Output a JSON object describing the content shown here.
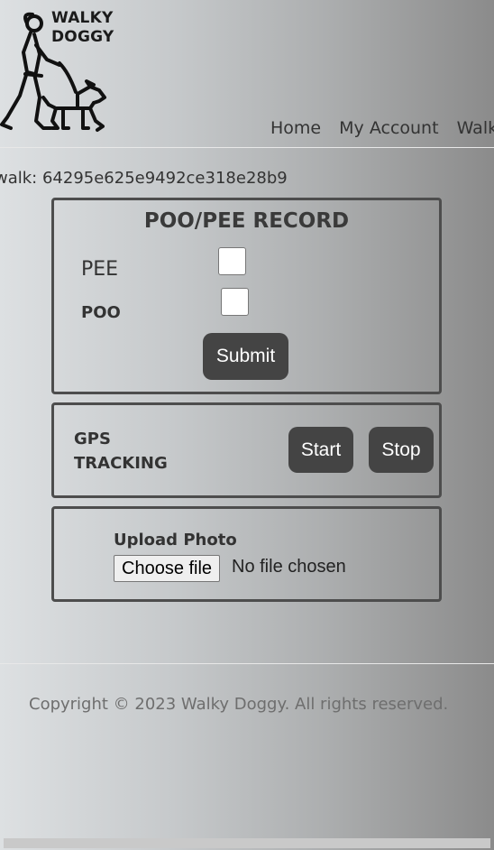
{
  "header": {
    "logo_line1": "WALKY",
    "logo_line2": "DOGGY",
    "nav": [
      "Home",
      "My Account",
      "Walke"
    ]
  },
  "walk": {
    "id_text": "walk: 64295e625e9492ce318e28b9"
  },
  "record": {
    "title": "POO/PEE RECORD",
    "pee_label": "PEE",
    "poo_label": "POO",
    "submit_label": "Submit"
  },
  "gps": {
    "label_line1": "GPS",
    "label_line2": "TRACKING",
    "start_label": "Start",
    "stop_label": "Stop"
  },
  "photo": {
    "label": "Upload Photo",
    "choose_label": "Choose file",
    "status": "No file chosen"
  },
  "footer": {
    "copyright": "Copyright © 2023 Walky Doggy. All rights reserved."
  },
  "icons": {
    "logo": "walking-dog-person-icon"
  }
}
